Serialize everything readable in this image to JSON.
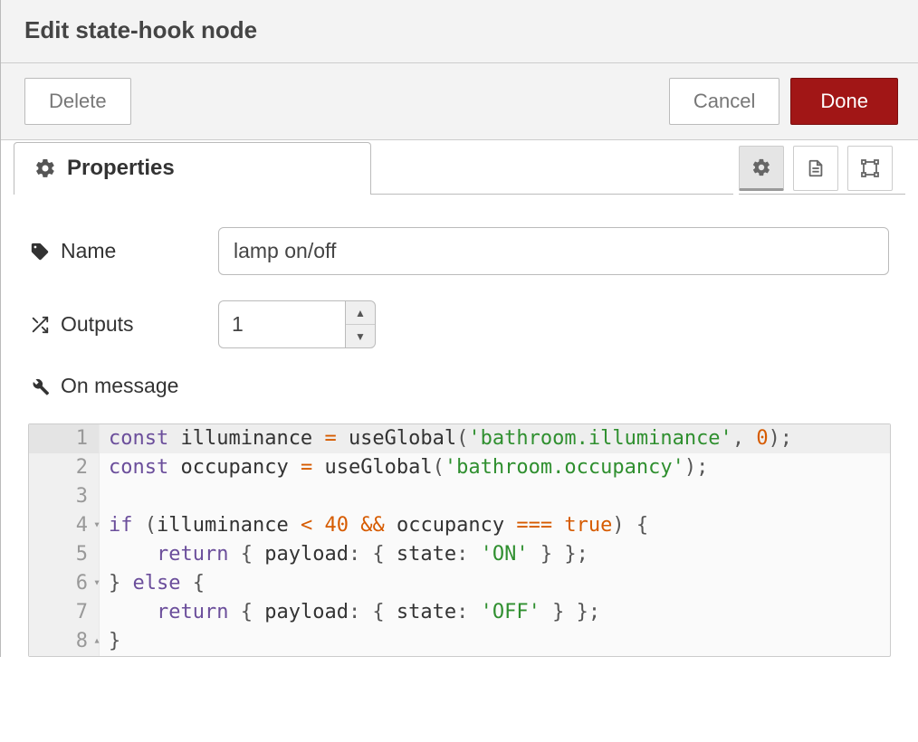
{
  "header": {
    "title": "Edit state-hook node"
  },
  "toolbar": {
    "delete_label": "Delete",
    "cancel_label": "Cancel",
    "done_label": "Done"
  },
  "tabs": {
    "properties_label": "Properties"
  },
  "form": {
    "name_label": "Name",
    "name_value": "lamp on/off",
    "outputs_label": "Outputs",
    "outputs_value": "1",
    "onmessage_label": "On message"
  },
  "editor": {
    "lines": [
      {
        "n": 1,
        "fold": "",
        "tokens": [
          [
            "kw",
            "const"
          ],
          [
            "sp",
            " "
          ],
          [
            "id",
            "illuminance"
          ],
          [
            "sp",
            " "
          ],
          [
            "op",
            "="
          ],
          [
            "sp",
            " "
          ],
          [
            "func",
            "useGlobal"
          ],
          [
            "punc",
            "("
          ],
          [
            "str",
            "'bathroom.illuminance'"
          ],
          [
            "punc",
            ", "
          ],
          [
            "num",
            "0"
          ],
          [
            "punc",
            ");"
          ]
        ]
      },
      {
        "n": 2,
        "fold": "",
        "tokens": [
          [
            "kw",
            "const"
          ],
          [
            "sp",
            " "
          ],
          [
            "id",
            "occupancy"
          ],
          [
            "sp",
            " "
          ],
          [
            "op",
            "="
          ],
          [
            "sp",
            " "
          ],
          [
            "func",
            "useGlobal"
          ],
          [
            "punc",
            "("
          ],
          [
            "str",
            "'bathroom.occupancy'"
          ],
          [
            "punc",
            ");"
          ]
        ]
      },
      {
        "n": 3,
        "fold": "",
        "tokens": []
      },
      {
        "n": 4,
        "fold": "▾",
        "tokens": [
          [
            "kw",
            "if"
          ],
          [
            "sp",
            " "
          ],
          [
            "punc",
            "("
          ],
          [
            "id",
            "illuminance"
          ],
          [
            "sp",
            " "
          ],
          [
            "op",
            "<"
          ],
          [
            "sp",
            " "
          ],
          [
            "num",
            "40"
          ],
          [
            "sp",
            " "
          ],
          [
            "op",
            "&&"
          ],
          [
            "sp",
            " "
          ],
          [
            "id",
            "occupancy"
          ],
          [
            "sp",
            " "
          ],
          [
            "op",
            "==="
          ],
          [
            "sp",
            " "
          ],
          [
            "true",
            "true"
          ],
          [
            "punc",
            ") {"
          ]
        ]
      },
      {
        "n": 5,
        "fold": "",
        "tokens": [
          [
            "sp",
            "    "
          ],
          [
            "kw",
            "return"
          ],
          [
            "sp",
            " "
          ],
          [
            "punc",
            "{ "
          ],
          [
            "id",
            "payload"
          ],
          [
            "punc",
            ": { "
          ],
          [
            "id",
            "state"
          ],
          [
            "punc",
            ": "
          ],
          [
            "str",
            "'ON'"
          ],
          [
            "punc",
            " } };"
          ]
        ]
      },
      {
        "n": 6,
        "fold": "▾",
        "tokens": [
          [
            "punc",
            "} "
          ],
          [
            "kw",
            "else"
          ],
          [
            "punc",
            " {"
          ]
        ]
      },
      {
        "n": 7,
        "fold": "",
        "tokens": [
          [
            "sp",
            "    "
          ],
          [
            "kw",
            "return"
          ],
          [
            "sp",
            " "
          ],
          [
            "punc",
            "{ "
          ],
          [
            "id",
            "payload"
          ],
          [
            "punc",
            ": { "
          ],
          [
            "id",
            "state"
          ],
          [
            "punc",
            ": "
          ],
          [
            "str",
            "'OFF'"
          ],
          [
            "punc",
            " } };"
          ]
        ]
      },
      {
        "n": 8,
        "fold": "▴",
        "tokens": [
          [
            "punc",
            "}"
          ]
        ]
      }
    ]
  }
}
